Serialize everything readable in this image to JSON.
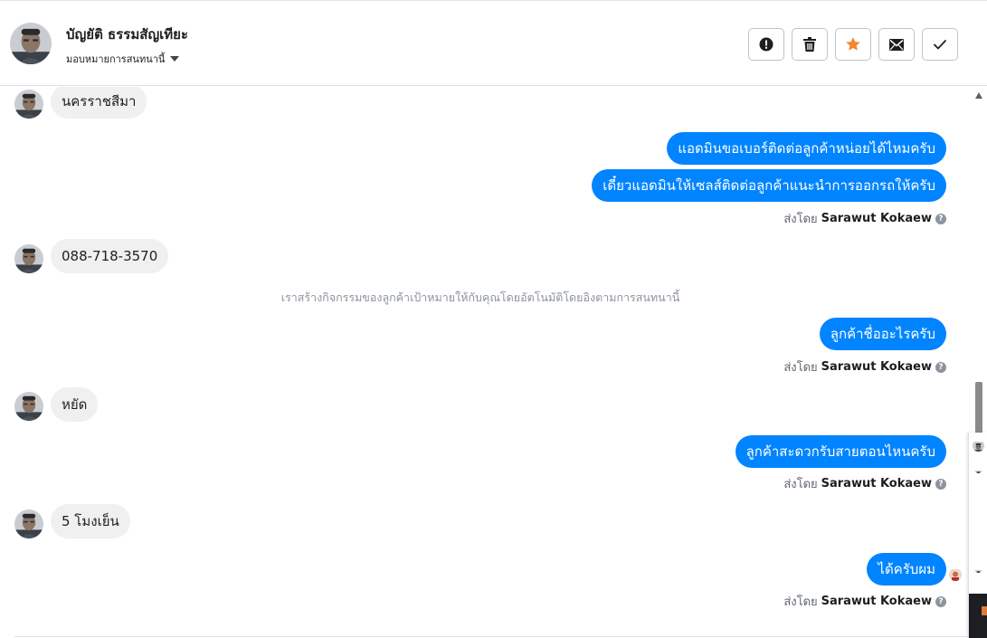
{
  "header": {
    "name": "บัญยัติ ธรรมสัญเทียะ",
    "assign_label": "มอบหมายการสนทนานี้"
  },
  "colors": {
    "outgoing_bubble": "#0084ff",
    "incoming_bubble": "#f0f0f0",
    "star": "#f38630"
  },
  "actions": [
    {
      "icon": "exclamation-icon"
    },
    {
      "icon": "trash-icon"
    },
    {
      "icon": "star-icon"
    },
    {
      "icon": "envelope-icon"
    },
    {
      "icon": "check-icon"
    }
  ],
  "messages": {
    "m1": "นครราชสีมา",
    "m2": "แอดมินขอเบอร์ติดต่อลูกค้าหน่อยได้ไหมครับ",
    "m3": "เดี๋ยวแอดมินให้เซลส์ติดต่อลูกค้าแนะนำการออกรถให้ครับ",
    "m4": "088-718-3570",
    "m5": "ลูกค้าชื่ออะไรครับ",
    "m6": "หยัด",
    "m7": "ลูกค้าสะดวกรับสายตอนไหนครับ",
    "m8": "5 โมงเย็น",
    "m9": "ได้ครับผม"
  },
  "sent_by": {
    "prefix": "ส่งโดย",
    "agent": "Sarawut Kokaew",
    "help": "?"
  },
  "system_note": "เราสร้างกิจกรรมของลูกค้าเป้าหมายให้กับคุณโดยอัตโนมัติโดยอิงตามการสนทนานี้"
}
